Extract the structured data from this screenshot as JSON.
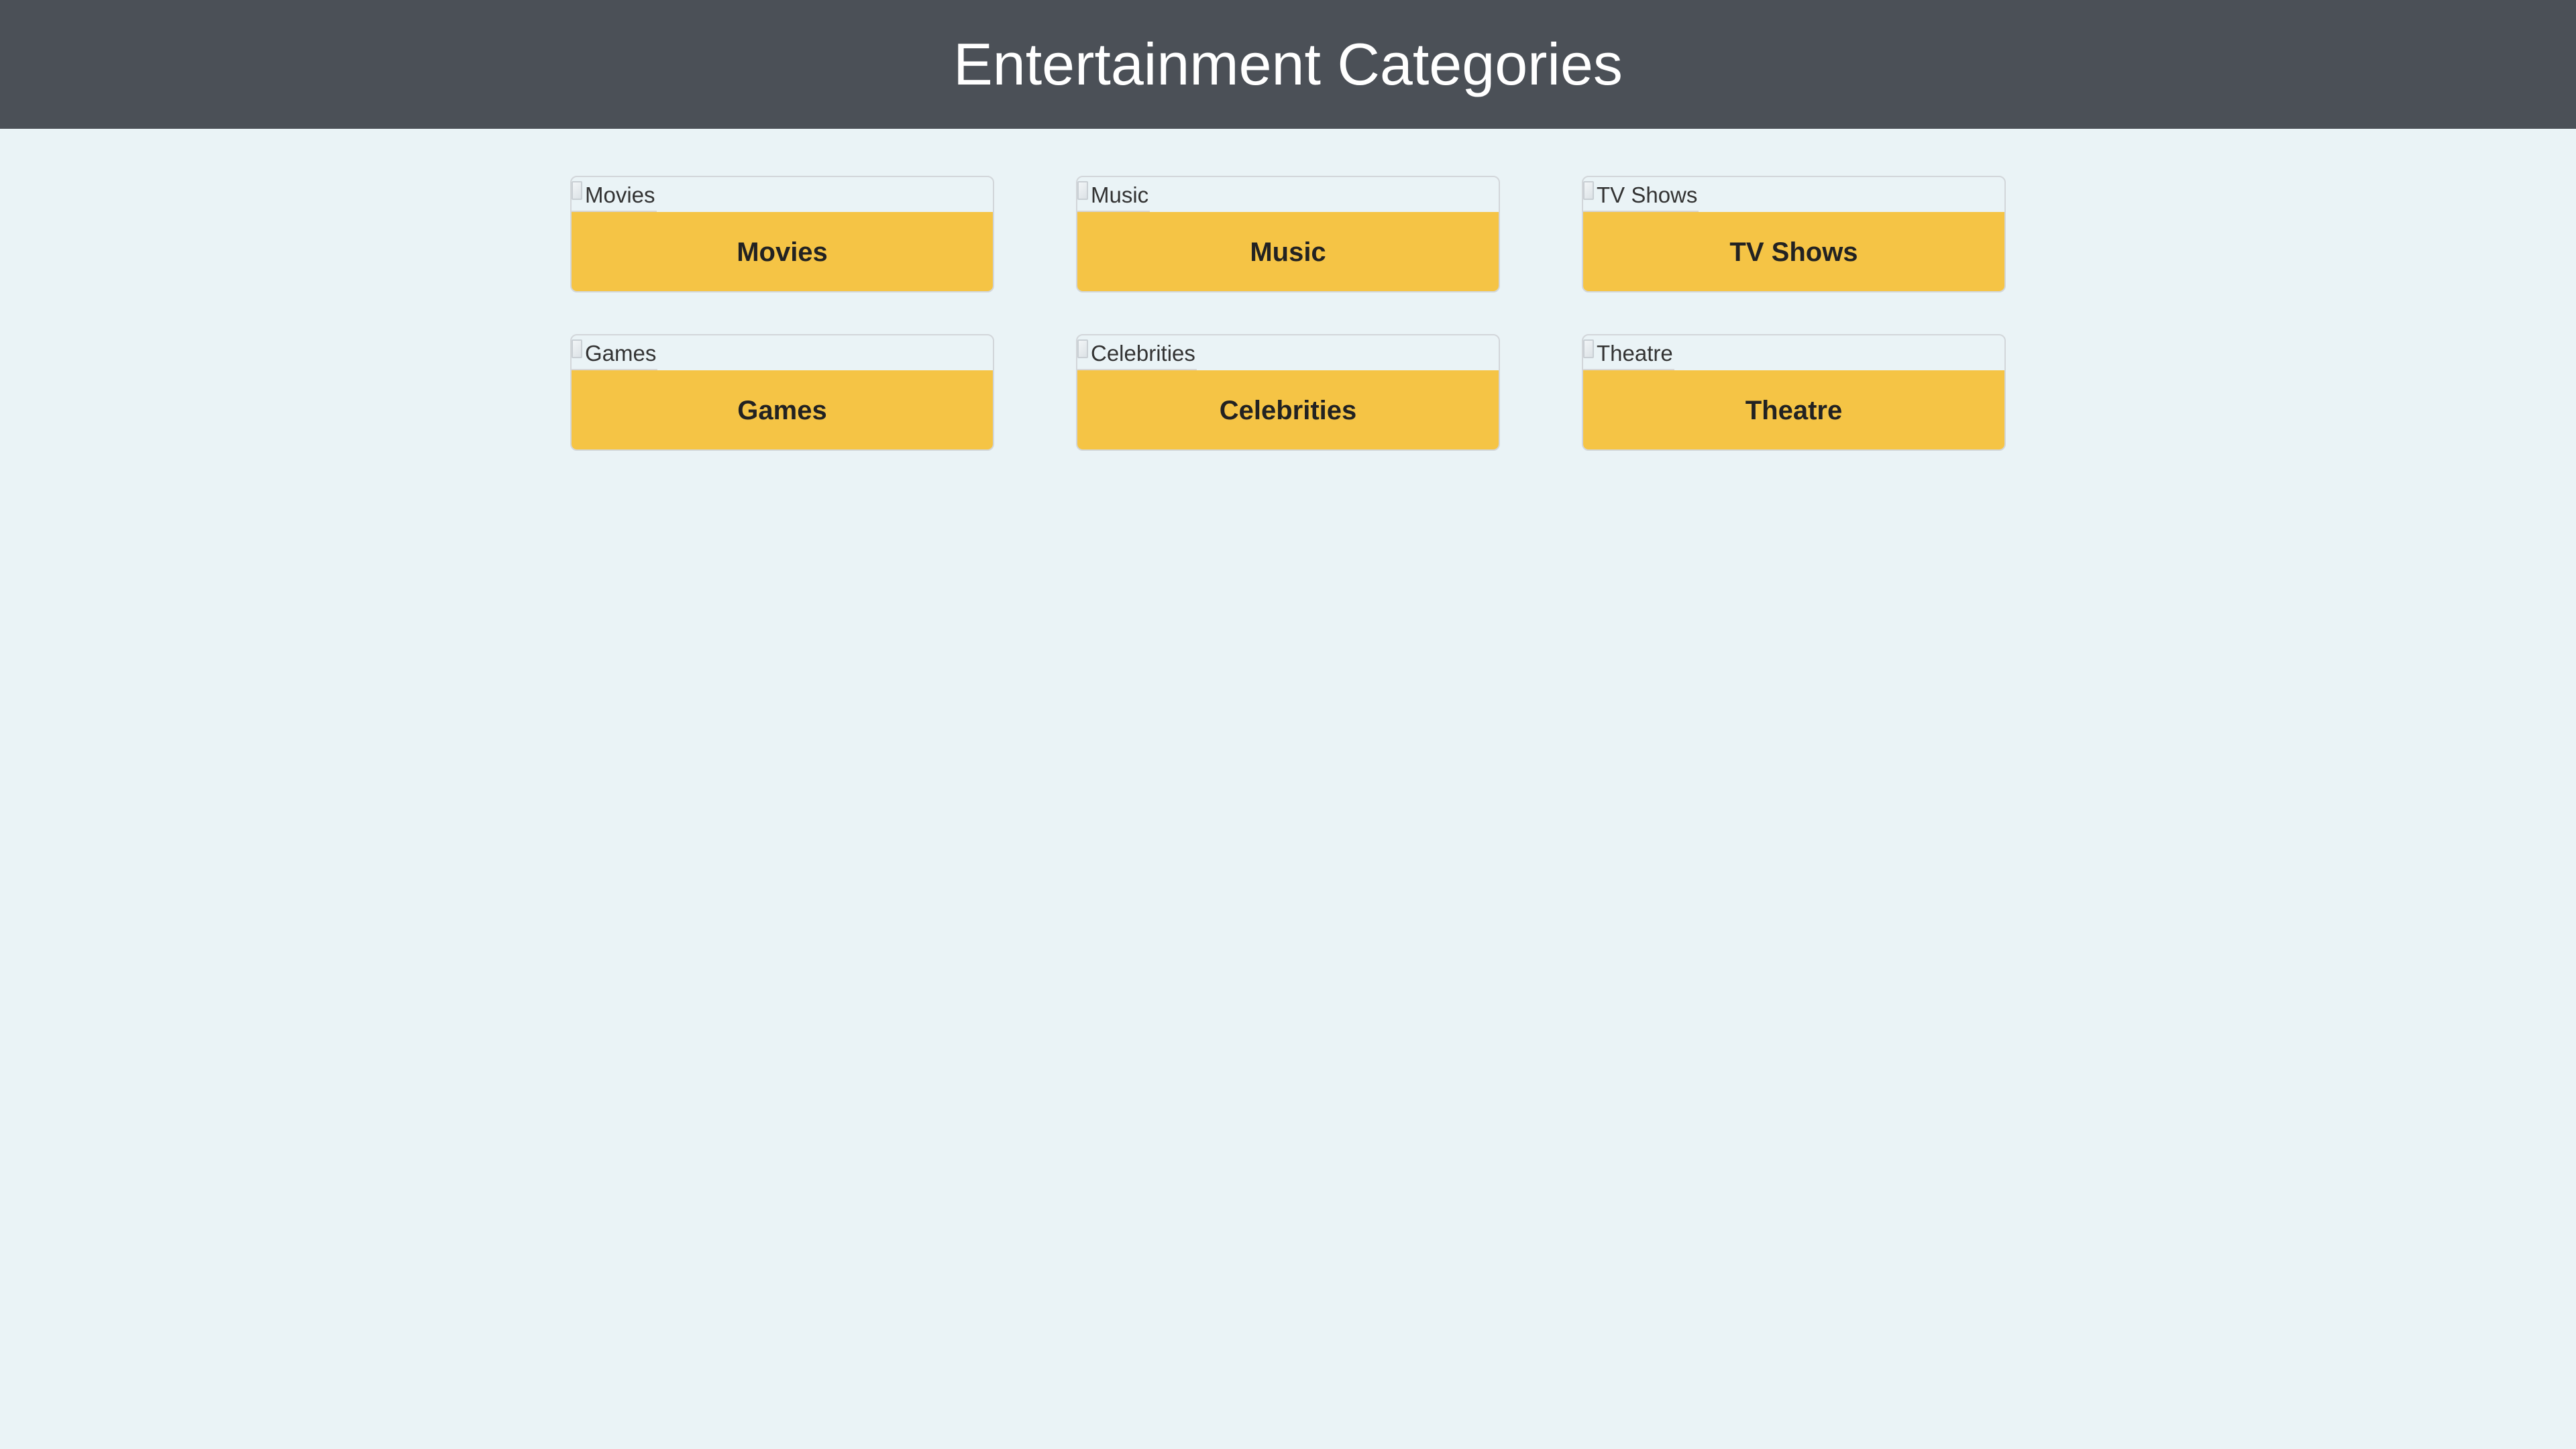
{
  "header": {
    "title": "Entertainment Categories"
  },
  "categories": [
    {
      "label": "Movies",
      "image_alt": "Movies"
    },
    {
      "label": "Music",
      "image_alt": "Music"
    },
    {
      "label": "TV Shows",
      "image_alt": "TV Shows"
    },
    {
      "label": "Games",
      "image_alt": "Games"
    },
    {
      "label": "Celebrities",
      "image_alt": "Celebrities"
    },
    {
      "label": "Theatre",
      "image_alt": "Theatre"
    }
  ],
  "colors": {
    "header_background": "#4b5057",
    "page_background": "#eaf3f6",
    "card_label_background": "#f5c445",
    "header_text": "#ffffff",
    "card_label_text": "#222222"
  },
  "icons": {
    "category_image": "broken-image-icon"
  }
}
